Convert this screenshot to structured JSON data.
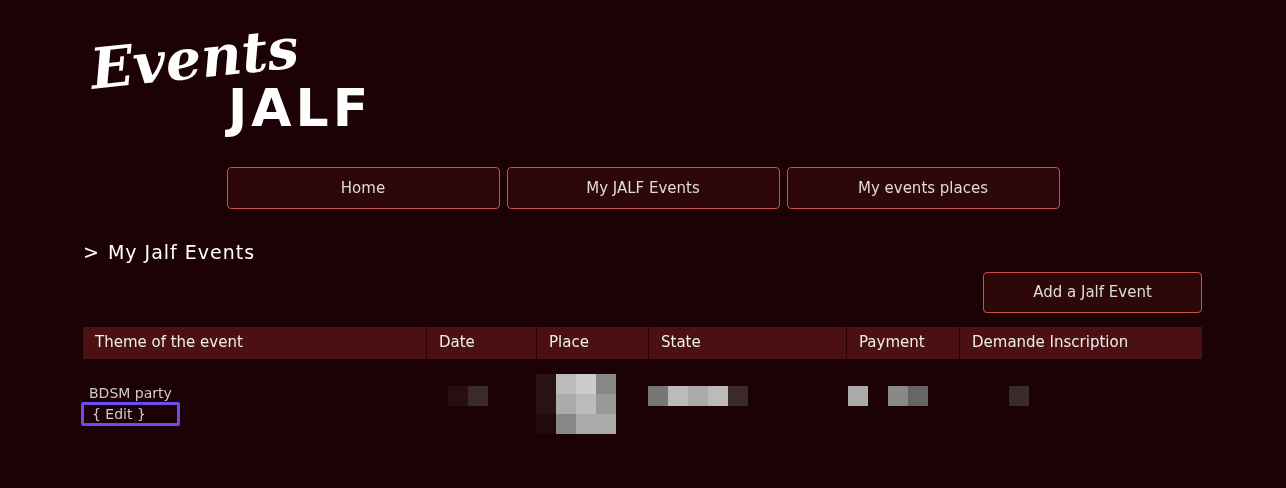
{
  "logo": {
    "script": "Events",
    "word": "JALF"
  },
  "nav": [
    {
      "label": "Home"
    },
    {
      "label": "My JALF Events"
    },
    {
      "label": "My events places"
    }
  ],
  "heading": {
    "marker": ">",
    "text": "My Jalf Events"
  },
  "add_button": "Add a Jalf Event",
  "table": {
    "columns": [
      "Theme of the event",
      "Date",
      "Place",
      "State",
      "Payment",
      "Demande Inscription"
    ],
    "rows": [
      {
        "theme": "BDSM party",
        "edit": {
          "label": "{ Edit }",
          "highlighted": true
        },
        "cells": [
          {
            "redacted": true
          },
          {
            "redacted": true
          },
          {
            "redacted": true
          },
          {
            "redacted": true
          },
          {
            "redacted": true
          }
        ]
      }
    ]
  }
}
